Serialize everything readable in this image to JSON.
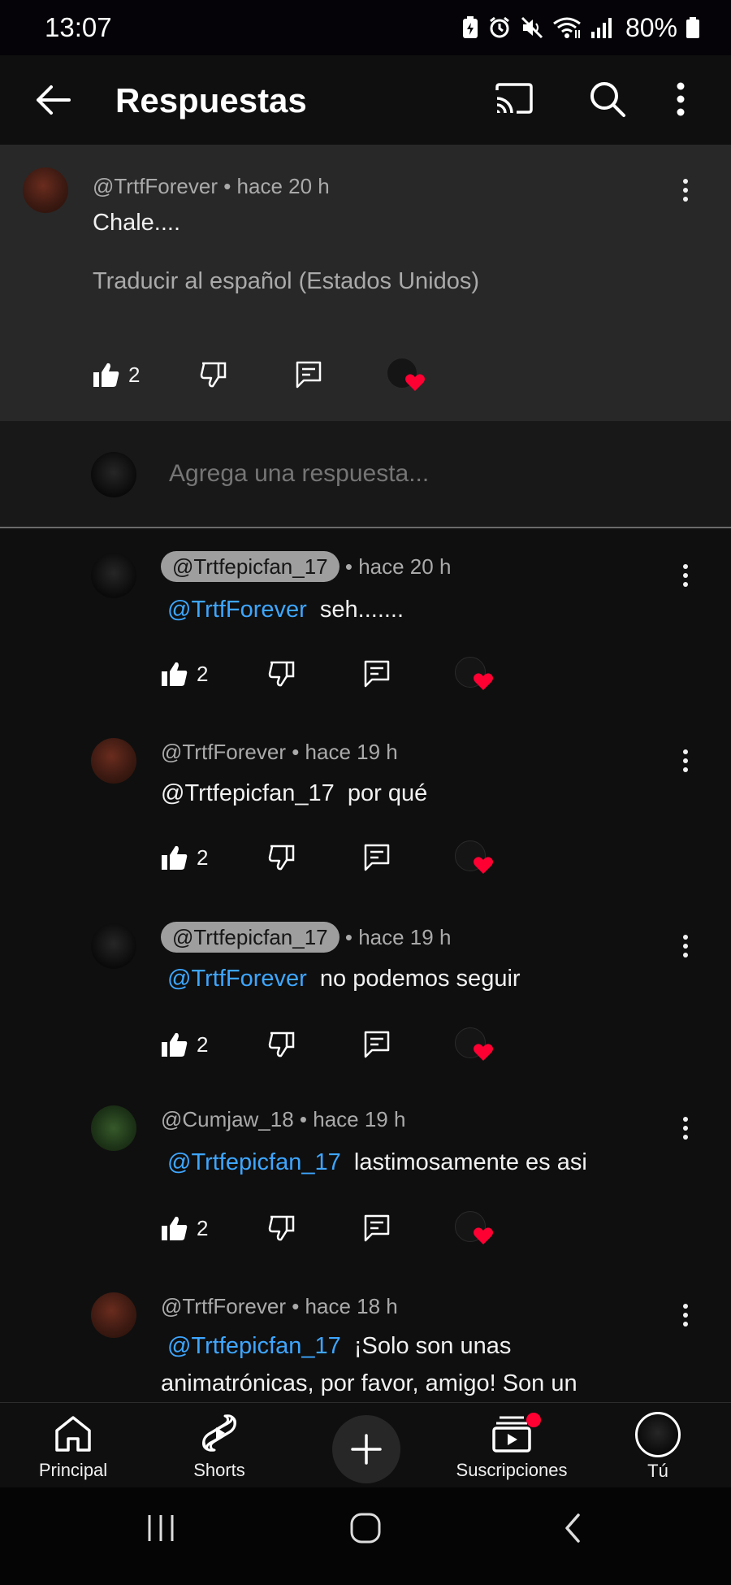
{
  "status_bar": {
    "time": "13:07",
    "battery": "80%"
  },
  "app_bar": {
    "title": "Respuestas"
  },
  "parent_comment": {
    "handle": "@TrtfForever",
    "time": "• hace 20 h",
    "text": "Chale....",
    "translate": "Traducir al español (Estados Unidos)",
    "likes": "2"
  },
  "reply_input": {
    "placeholder": "Agrega una respuesta..."
  },
  "replies": [
    {
      "handle": "@Trtfepicfan_17",
      "time": "• hace 20 h",
      "mention": "@TrtfForever",
      "text": "seh.......",
      "likes": "2"
    },
    {
      "handle": "@TrtfForever",
      "time": "• hace 19 h",
      "mention": "@Trtfepicfan_17",
      "text": "por qué",
      "likes": "2"
    },
    {
      "handle": "@Trtfepicfan_17",
      "time": "• hace 19 h",
      "mention": "@TrtfForever",
      "text": "no podemos seguir",
      "likes": "2"
    },
    {
      "handle": "@Cumjaw_18",
      "time": "• hace 19 h",
      "mention": "@Trtfepicfan_17",
      "text": "lastimosamente es asi",
      "likes": "2"
    },
    {
      "handle": "@TrtfForever",
      "time": "• hace 18 h",
      "mention": "@Trtfepicfan_17",
      "text": "¡Solo son unas",
      "text_line2": "animatrónicas, por favor, amigo! Son un"
    }
  ],
  "bottom_nav": {
    "home": "Principal",
    "shorts": "Shorts",
    "subscriptions": "Suscripciones",
    "you": "Tú"
  },
  "colors": {
    "mention": "#3ea6ff",
    "heart": "#ff0033",
    "background": "#0f0f0f",
    "highlight": "#282828"
  }
}
